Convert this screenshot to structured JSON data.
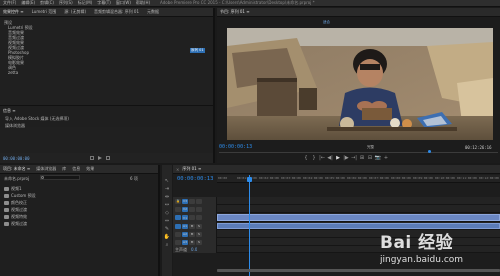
{
  "menubar": {
    "items": [
      "文件(F)",
      "编辑(E)",
      "剪辑(C)",
      "序列(S)",
      "标记(M)",
      "字幕(T)",
      "窗口(W)",
      "帮助(H)"
    ],
    "title": "Adobe Premiere Pro CC 2015 - C:\\Users\\Administrator\\Desktop\\未命名.prproj *"
  },
  "effect_controls": {
    "tabs": [
      "效果控件 ≡",
      "Lumetri 范围",
      "源: (无剪辑)",
      "音频剪辑混合器: 序列 01",
      "元数据"
    ],
    "items": [
      "预设",
      "Lumetri 预设",
      "音频效果",
      "音频过渡",
      "视频效果",
      "视频过渡",
      "Photoshop",
      "模拟胶片",
      "电影效果",
      "调色",
      "zetta"
    ],
    "timecode": "00:00:00:00",
    "badge": "序列 01"
  },
  "info_panel": {
    "title": "信息 ≡",
    "line1": "导入 Adobe Stock 媒体 (无选择项)",
    "line2": "媒体浏览器"
  },
  "program_monitor": {
    "title": "节目: 序列 01 ≡",
    "zoom": "适合",
    "quality": "完整",
    "timecode_left": "00:00:00:13",
    "timecode_right": "00:12:26:16",
    "controls": [
      "{",
      "}",
      "|←",
      "◀|",
      "▶",
      "|▶",
      "→|",
      "⊞",
      "⊟",
      "📷",
      "+"
    ]
  },
  "project_panel": {
    "tabs": [
      "项目: 未命名 ≡",
      "媒体浏览器",
      "库",
      "信息",
      "效果"
    ],
    "breadcrumb": "未命名.prproj",
    "items": [
      "视频1",
      "Custom 预设",
      "颜色校正",
      "视频过渡",
      "视频特效",
      "视频过渡"
    ],
    "count": "6 项"
  },
  "timeline": {
    "title": "序列 01 ≡",
    "timecode": "00:00:00:13",
    "ruler": [
      "00:00",
      "00:01:00:00",
      "00:02:00:00",
      "00:03:00:00",
      "00:04:00:00",
      "00:05:00:00",
      "00:06:00:00",
      "00:07:00:00",
      "00:08:00:00",
      "00:09:00:00",
      "00:10:00:00",
      "00:11:00:00",
      "00:12:00:00"
    ],
    "video_tracks": [
      "V3",
      "V2",
      "V1"
    ],
    "audio_tracks": [
      "A1",
      "A2",
      "A3"
    ],
    "master": "主声道",
    "master_val": "0.0"
  },
  "watermark": {
    "brand": "Bai 经验",
    "url": "jingyan.baidu.com"
  },
  "colors": {
    "accent": "#2d8ceb",
    "clip_video": "#6b88c4",
    "clip_audio": "#5b7cb8"
  }
}
